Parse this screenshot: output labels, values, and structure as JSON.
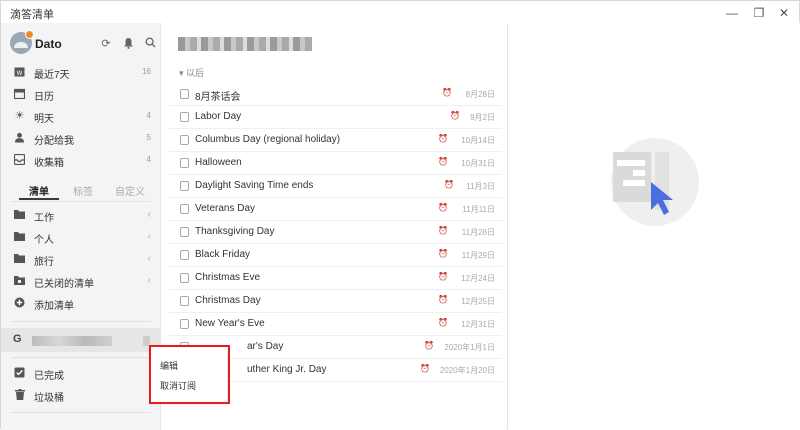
{
  "window": {
    "title": "滴答清单",
    "controls": [
      "minimize-icon",
      "restore-icon",
      "close-icon"
    ]
  },
  "user": {
    "name": "Dato"
  },
  "smart_lists": [
    {
      "label": "最近7天",
      "count": "16",
      "icon": "calendar-7-icon"
    },
    {
      "label": "日历",
      "count": "",
      "icon": "calendar-icon"
    },
    {
      "label": "明天",
      "count": "4",
      "icon": "sunrise-icon"
    },
    {
      "label": "分配给我",
      "count": "5",
      "icon": "person-icon"
    },
    {
      "label": "收集箱",
      "count": "4",
      "icon": "inbox-icon"
    }
  ],
  "tabs": [
    {
      "label": "清单",
      "active": true
    },
    {
      "label": "标签",
      "active": false
    },
    {
      "label": "自定义",
      "active": false
    }
  ],
  "folders": [
    {
      "label": "工作"
    },
    {
      "label": "个人"
    },
    {
      "label": "旅行"
    },
    {
      "label": "已关闭的清单"
    }
  ],
  "add_list": {
    "label": "添加清单"
  },
  "bottom_items": [
    {
      "label": "已完成",
      "icon": "check-square-icon"
    },
    {
      "label": "垃圾桶",
      "icon": "trash-icon"
    }
  ],
  "section": {
    "label": "以后"
  },
  "tasks": [
    {
      "title": "8月茶话会",
      "date": "8月28日"
    },
    {
      "title": "Labor Day",
      "date": "9月2日"
    },
    {
      "title": "Columbus Day (regional holiday)",
      "date": "10月14日"
    },
    {
      "title": "Halloween",
      "date": "10月31日"
    },
    {
      "title": "Daylight Saving Time ends",
      "date": "11月3日"
    },
    {
      "title": "Veterans Day",
      "date": "11月11日"
    },
    {
      "title": "Thanksgiving Day",
      "date": "11月28日"
    },
    {
      "title": "Black Friday",
      "date": "11月29日"
    },
    {
      "title": "Christmas Eve",
      "date": "12月24日"
    },
    {
      "title": "Christmas Day",
      "date": "12月25日"
    },
    {
      "title": "New Year's Eve",
      "date": "12月31日"
    },
    {
      "title": "ar's Day",
      "date": "2020年1月1日"
    },
    {
      "title": "uther King Jr. Day",
      "date": "2020年1月20日"
    }
  ],
  "context_menu": {
    "items": [
      "编辑",
      "取消订阅"
    ]
  },
  "colors": {
    "accent": "#4a6ee0",
    "highlight_border": "#e31d1d"
  }
}
